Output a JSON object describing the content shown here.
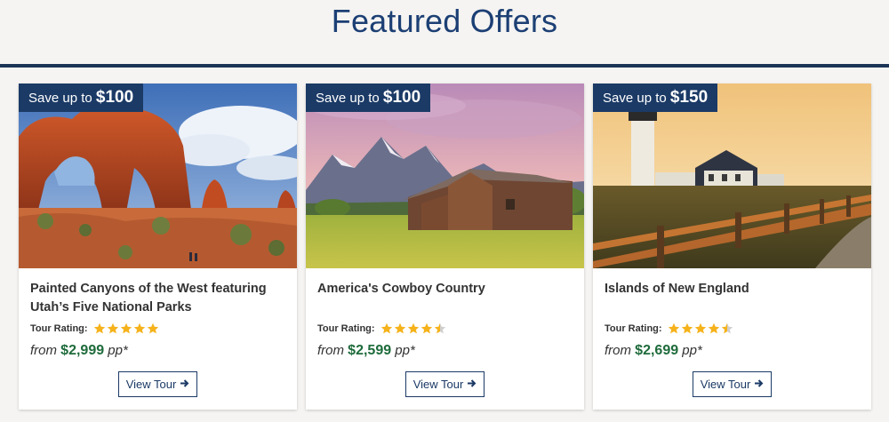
{
  "header": {
    "title": "Featured Offers"
  },
  "colors": {
    "brand_navy": "#1b3a66",
    "price_green": "#1e6b3b",
    "star_gold": "#f5b21b"
  },
  "cards": [
    {
      "badge_prefix": "Save up to",
      "badge_amount": "$100",
      "title": "Painted Canyons of the West featuring Utah’s Five National Parks",
      "rating_label": "Tour Rating:",
      "rating": 5,
      "price_prefix": "from",
      "price": "$2,999",
      "price_suffix": "pp*",
      "button_label": "View Tour",
      "image_icon": "red-rock-arch-photo"
    },
    {
      "badge_prefix": "Save up to",
      "badge_amount": "$100",
      "title": "America's Cowboy Country",
      "rating_label": "Tour Rating:",
      "rating": 4.5,
      "price_prefix": "from",
      "price": "$2,599",
      "price_suffix": "pp*",
      "button_label": "View Tour",
      "image_icon": "mountain-barn-photo"
    },
    {
      "badge_prefix": "Save up to",
      "badge_amount": "$150",
      "title": "Islands of New England",
      "rating_label": "Tour Rating:",
      "rating": 4.5,
      "price_prefix": "from",
      "price": "$2,699",
      "price_suffix": "pp*",
      "button_label": "View Tour",
      "image_icon": "lighthouse-photo"
    }
  ]
}
